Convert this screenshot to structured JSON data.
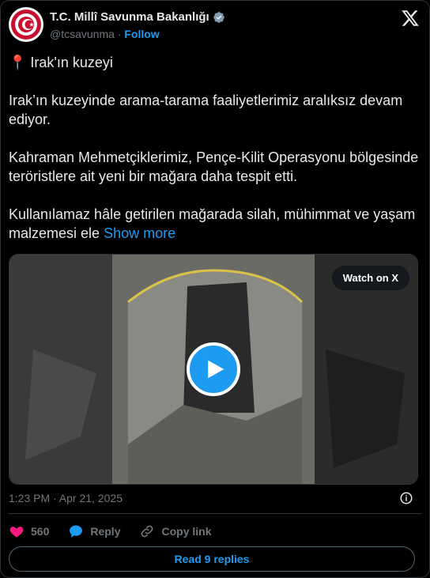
{
  "header": {
    "name": "T.C. Millî Savunma Bakanlığı",
    "handle": "@tcsavunma",
    "separator": "·",
    "follow_label": "Follow"
  },
  "tweet": {
    "line1": "📍 Irak'ın kuzeyi",
    "para1": "Irak’ın kuzeyinde arama-tarama faaliyetlerimiz aralıksız devam ediyor.",
    "para2": "Kahraman Mehmetçiklerimiz, Pençe-Kilit Operasyonu bölgesinde teröristlere ait yeni bir mağara daha tespit etti.",
    "para3": "Kullanılamaz hâle getirilen mağarada silah, mühimmat ve yaşam malzemesi ele",
    "show_more": "Show more"
  },
  "media": {
    "watch_label": "Watch on X"
  },
  "meta": {
    "timestamp": "1:23 PM · Apr 21, 2025"
  },
  "actions": {
    "like_count": "560",
    "reply_label": "Reply",
    "copy_link_label": "Copy link"
  },
  "footer": {
    "read_replies_label": "Read 9 replies"
  },
  "colors": {
    "accent": "#1d9bf0",
    "like": "#f91880",
    "muted": "#71767b",
    "background": "#000000",
    "text": "#e7e9ea"
  },
  "icons": [
    "ministry-logo-icon",
    "verified-icon",
    "x-logo-icon",
    "play-icon",
    "info-icon",
    "heart-icon",
    "reply-icon",
    "link-icon"
  ]
}
